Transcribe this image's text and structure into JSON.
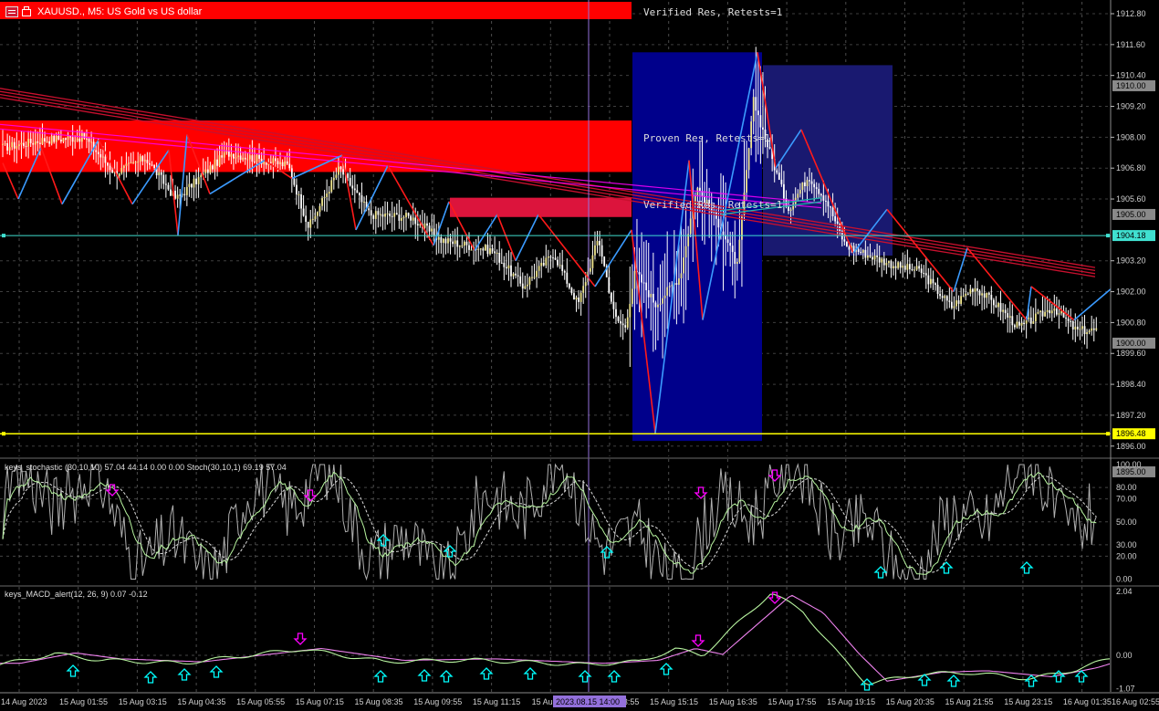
{
  "header": {
    "symbol_line": "XAUUSD., M5:  US Gold vs US dollar"
  },
  "zones": {
    "verified_top": "Verified Res, Retests=1",
    "proven": "Proven Res, Retests=1",
    "verified_mid": "Verified Res, Retests=1"
  },
  "stoch_panel": {
    "label": "keys_stochastic (30,10,10) 57.04 44.14 0.00 0.00 Stoch(30,10,1) 69.19 57.04",
    "levels": [
      "100.00",
      "80.00",
      "70.00",
      "50.00",
      "30.00",
      "20.00",
      "0.00"
    ]
  },
  "macd_panel": {
    "label": "keys_MACD_alert(12, 26, 9) 0.07 -0.12",
    "levels": [
      "2.04",
      "0.00",
      "-1.07"
    ]
  },
  "price_axis": [
    {
      "label": "1912.80",
      "v": 1912.8
    },
    {
      "label": "1911.60",
      "v": 1911.6
    },
    {
      "label": "1910.40",
      "v": 1910.4
    },
    {
      "label": "1909.20",
      "v": 1909.2
    },
    {
      "label": "1908.00",
      "v": 1908.0
    },
    {
      "label": "1906.80",
      "v": 1906.8
    },
    {
      "label": "1905.60",
      "v": 1905.6
    },
    {
      "label": "1903.20",
      "v": 1903.2
    },
    {
      "label": "1902.00",
      "v": 1902.0
    },
    {
      "label": "1900.80",
      "v": 1900.8
    },
    {
      "label": "1899.60",
      "v": 1899.6
    },
    {
      "label": "1898.40",
      "v": 1898.4
    },
    {
      "label": "1897.20",
      "v": 1897.2
    },
    {
      "label": "1896.00",
      "v": 1896.0
    }
  ],
  "price_tags": [
    {
      "label": "1910.00",
      "v": 1910.0,
      "style": "grey"
    },
    {
      "label": "1905.00",
      "v": 1905.0,
      "style": "grey"
    },
    {
      "label": "1904.18",
      "v": 1904.18,
      "style": "cyan"
    },
    {
      "label": "1900.00",
      "v": 1900.0,
      "style": "grey"
    },
    {
      "label": "1896.48",
      "v": 1896.48,
      "style": "yellow"
    },
    {
      "label": "1895.00",
      "v": 1895.0,
      "style": "grey"
    }
  ],
  "time_axis": [
    "14 Aug 2023",
    "15 Aug 01:55",
    "15 Aug 03:15",
    "15 Aug 04:35",
    "15 Aug 05:55",
    "15 Aug 07:15",
    "15 Aug 08:35",
    "15 Aug 09:55",
    "15 Aug 11:15",
    "15 Aug 12:35",
    "15 Aug 13:55",
    "15 Aug 15:15",
    "15 Aug 16:35",
    "15 Aug 17:55",
    "15 Aug 19:15",
    "15 Aug 20:35",
    "15 Aug 21:55",
    "15 Aug 23:15",
    "16 Aug 01:35",
    "16 Aug 02:55"
  ],
  "cursor_time": "2023.08.15 14:00",
  "colors": {
    "background": "#000000",
    "grid": "#8a8a8a",
    "candle": "#ffffff",
    "bull_body": "#f0e68c",
    "zigzag_up": "#3b9bff",
    "zigzag_down": "#ff1a1a",
    "zone_red": "#ff0000",
    "zone_crimson": "#dc143c",
    "zone_navy": "#00008b",
    "zone_darkblue": "#191970",
    "ma_red": "#c8102e",
    "ma_magenta": "#ff00ff",
    "ma_teal": "#20b2aa",
    "hline_cyan": "#40e0d0",
    "hline_yellow": "#ffff00",
    "cursor": "#9370db",
    "arrow_up": "#00ffff",
    "arrow_down": "#ff00ff"
  }
}
